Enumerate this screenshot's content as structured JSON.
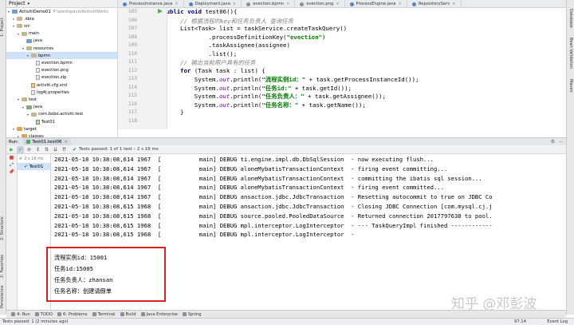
{
  "left_tabs": [
    "1: Project",
    "2: Structure",
    "2: Favorites",
    "Persistence"
  ],
  "right_tabs": [
    "Database",
    "Bean Validation",
    "Maven"
  ],
  "project": {
    "header": "Project",
    "tree": [
      {
        "label": "ActivitiDemo01",
        "extra": "F:\\workspace\\ActivitiWorks",
        "indent": 0,
        "icon": "fold-blue",
        "arrow": "▾"
      },
      {
        "label": ".idea",
        "indent": 1,
        "icon": "fold-plain",
        "arrow": "▸"
      },
      {
        "label": "src",
        "indent": 1,
        "icon": "fold-plain",
        "arrow": "▾"
      },
      {
        "label": "main",
        "indent": 2,
        "icon": "fold-plain",
        "arrow": "▾"
      },
      {
        "label": "java",
        "indent": 3,
        "icon": "fold-blue",
        "arrow": ""
      },
      {
        "label": "resources",
        "indent": 3,
        "icon": "fold-plain",
        "arrow": "▾"
      },
      {
        "label": "bpmn",
        "indent": 4,
        "icon": "fold-plain",
        "arrow": "▾",
        "selected": true
      },
      {
        "label": "evection.bpmn",
        "indent": 5,
        "icon": "file",
        "arrow": ""
      },
      {
        "label": "evection.png",
        "indent": 5,
        "icon": "file",
        "arrow": ""
      },
      {
        "label": "evection.zip",
        "indent": 5,
        "icon": "file",
        "arrow": ""
      },
      {
        "label": "activiti.cfg.xml",
        "indent": 4,
        "icon": "file-orange",
        "arrow": ""
      },
      {
        "label": "log4j.properties",
        "indent": 4,
        "icon": "file",
        "arrow": ""
      },
      {
        "label": "test",
        "indent": 2,
        "icon": "fold-plain",
        "arrow": "▾"
      },
      {
        "label": "java",
        "indent": 3,
        "icon": "fold-green",
        "arrow": "▾"
      },
      {
        "label": "com.bobo.activiti.test",
        "indent": 4,
        "icon": "fold-plain",
        "arrow": "▾"
      },
      {
        "label": "Test01",
        "indent": 5,
        "icon": "file-green",
        "arrow": ""
      },
      {
        "label": "target",
        "indent": 1,
        "icon": "fold-orange",
        "arrow": "▾"
      },
      {
        "label": "classes",
        "indent": 2,
        "icon": "fold-orange",
        "arrow": "▸"
      }
    ]
  },
  "editor_tabs": [
    {
      "label": "ProcessInstance.java",
      "color": "#4a86c8"
    },
    {
      "label": "Deployment.java",
      "color": "#4a86c8"
    },
    {
      "label": "evection.bpmn",
      "color": "#8a8f96"
    },
    {
      "label": "evection.png",
      "color": "#8a8f96"
    },
    {
      "label": "ProcessEngine.java",
      "color": "#4a86c8"
    },
    {
      "label": "RepositoryServ",
      "color": "#4a86c8"
    }
  ],
  "code": {
    "line_numbers": [
      "105",
      "106",
      "107",
      "108",
      "109",
      "110",
      "111",
      "112",
      "113",
      "114",
      "115",
      "116",
      "117",
      "118"
    ]
  },
  "run": {
    "label": "Run:",
    "config": "Test01.test06",
    "tests_passed": "Tests passed: 1 of 1 test – 2 s 16 ms",
    "tree_time": "2 s 16 ms",
    "tree_item": "Test01"
  },
  "log_lines": [
    "2021-05-18 10:38:08,614 1967  [           main] DEBUG ti.engine.impl.db.DbSqlSession  - now executing flush...",
    "2021-05-18 10:38:08,614 1967  [           main] DEBUG aloneMybatisTransactionContext  - firing event committing...",
    "2021-05-18 10:38:08,614 1967  [           main] DEBUG aloneMybatisTransactionContext  - committing the ibatis sql session...",
    "2021-05-18 10:38:08,614 1967  [           main] DEBUG aloneMybatisTransactionContext  - firing event committed...",
    "2021-05-18 10:38:08,614 1967  [           main] DEBUG ansaction.jdbc.JdbcTransaction  - Resetting autocommit to true on JDBC Co",
    "2021-05-18 10:38:08,615 1968  [           main] DEBUG ansaction.jdbc.JdbcTransaction  - Closing JDBC Connection [com.mysql.cj.j",
    "2021-05-18 10:38:08,615 1968  [           main] DEBUG source.pooled.PooledDataSource  - Returned connection 2017797638 to pool.",
    "2021-05-18 10:38:08,615 1968  [           main] DEBUG mpl.interceptor.LogInterceptor  - --- TaskQueryImpl finished ------------",
    "2021-05-18 10:38:08,615 1968  [           main] DEBUG mpl.interceptor.LogInterceptor  -"
  ],
  "output_lines": [
    "流程实例id：15001",
    "任务id:15005",
    "任务负责人：zhansan",
    "任务名称：创建请假单"
  ],
  "watermark": "知乎 @邓彭波",
  "bottom_tools": [
    "4: Run",
    "TODO",
    "6: Problems",
    "Terminal",
    "Build",
    "Java Enterprise",
    "Spring"
  ],
  "status": {
    "left": "Tests passed: 1 (2 minutes ago)",
    "event_log": "Event Log",
    "position": "97:14"
  },
  "colors": {
    "highlight": "#e02020",
    "keyword": "#000080",
    "string": "#008000",
    "comment": "#808080"
  }
}
